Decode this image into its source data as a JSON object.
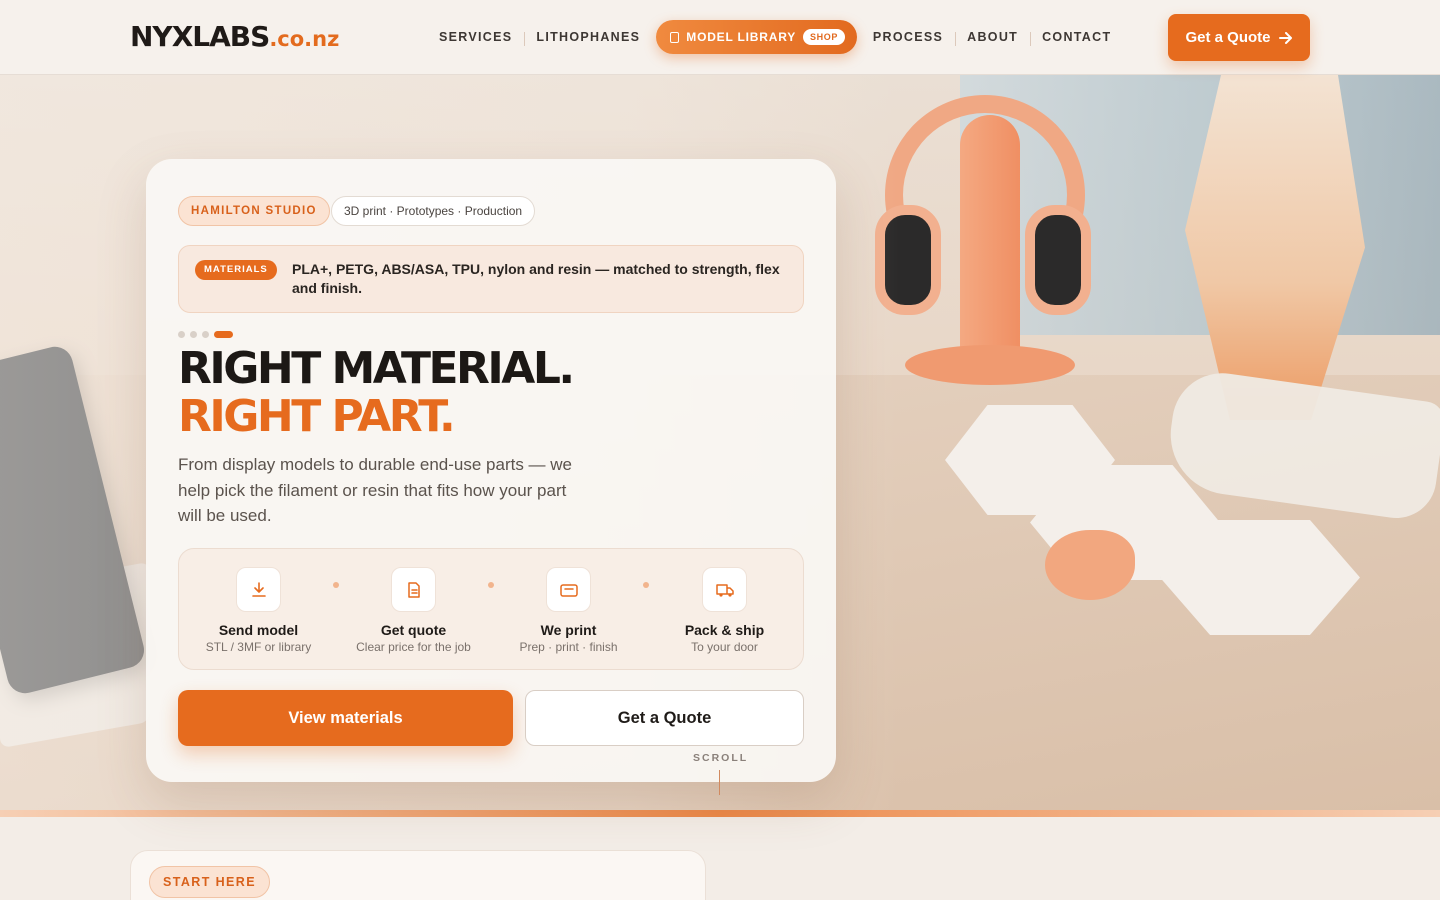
{
  "brand": {
    "name": "NYXLABS",
    "tld": ".co.nz"
  },
  "nav": {
    "links": [
      "SERVICES",
      "LITHOPHANES",
      "PROCESS",
      "ABOUT",
      "CONTACT"
    ],
    "library_label": "MODEL LIBRARY",
    "library_badge": "SHOP",
    "cta_label": "Get a Quote"
  },
  "hero": {
    "studio_chip": "HAMILTON STUDIO",
    "tags_chip": "3D print · Prototypes · Production",
    "materials_badge": "MATERIALS",
    "materials_text": "PLA+, PETG, ABS/ASA, TPU, nylon and resin — matched to strength, flex and finish.",
    "slide_count": 4,
    "active_slide": 4,
    "headline_line1": "RIGHT MATERIAL.",
    "headline_line2": "RIGHT PART.",
    "subtext": "From display models to durable end-use parts — we help pick the filament or resin that fits how your part will be used.",
    "steps": [
      {
        "icon": "download-icon",
        "title": "Send model",
        "sub": "STL / 3MF or library"
      },
      {
        "icon": "document-icon",
        "title": "Get quote",
        "sub": "Clear price for the job"
      },
      {
        "icon": "printer-icon",
        "title": "We print",
        "sub": "Prep · print · finish"
      },
      {
        "icon": "truck-icon",
        "title": "Pack & ship",
        "sub": "To your door"
      }
    ],
    "primary_button": "View materials",
    "secondary_button": "Get a Quote",
    "scroll_label": "SCROLL"
  },
  "lower": {
    "chip": "START HERE"
  },
  "colors": {
    "accent": "#e66b1e",
    "dark": "#1c1815",
    "bg": "#f6f1ec"
  }
}
